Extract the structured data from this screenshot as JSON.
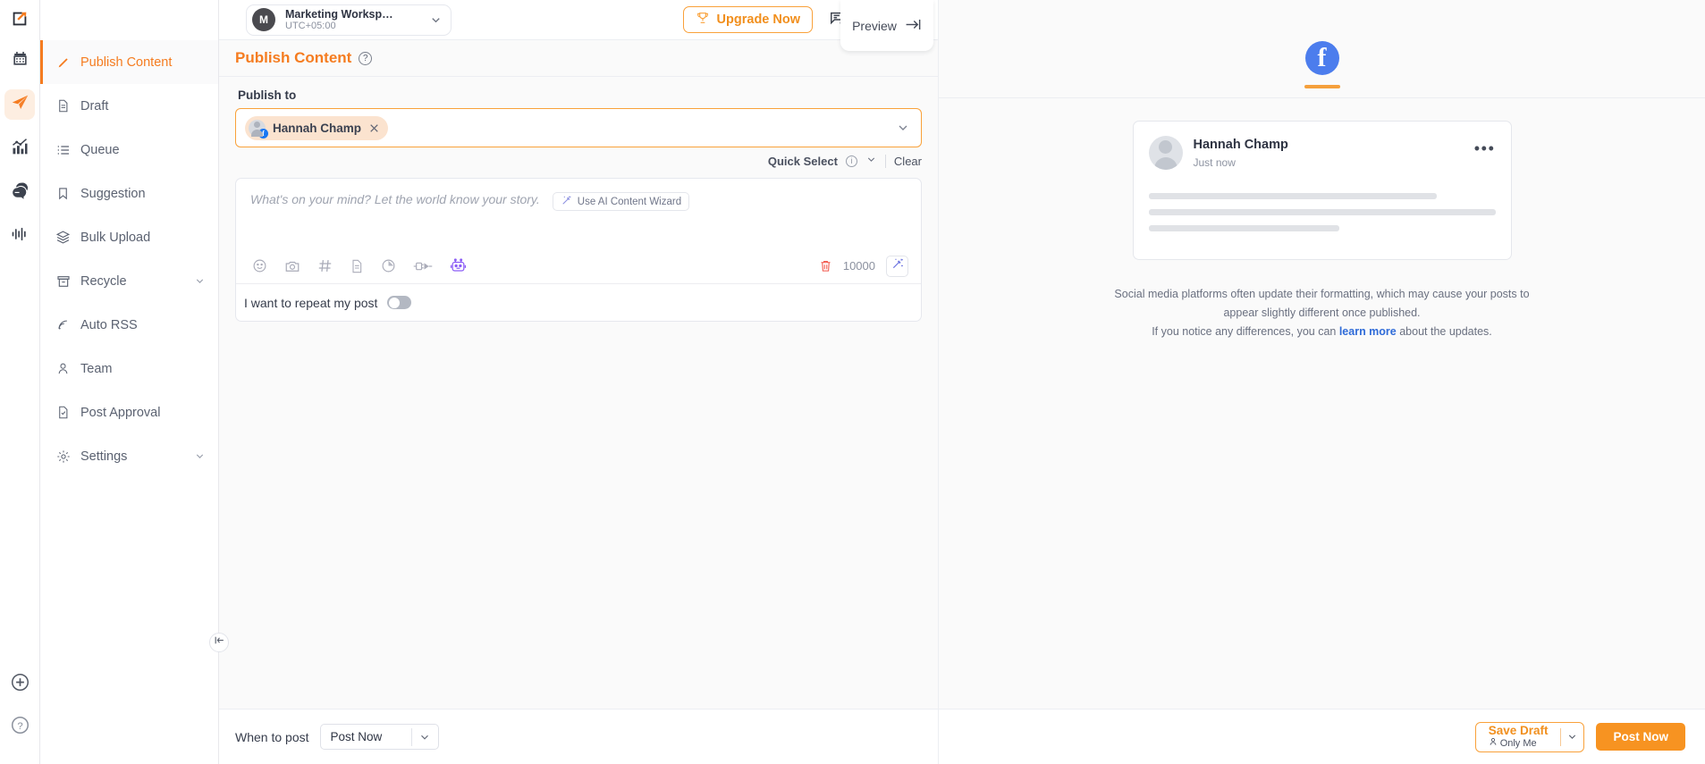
{
  "rail": {
    "logo_icon": "app-logo-icon",
    "items": [
      {
        "icon": "calendar-icon",
        "name": "calendar",
        "active": false
      },
      {
        "icon": "paper-plane-icon",
        "name": "publish",
        "active": true
      },
      {
        "icon": "analytics-chart-icon",
        "name": "analytics",
        "active": false
      },
      {
        "icon": "chat-bubbles-icon",
        "name": "inbox",
        "active": false
      },
      {
        "icon": "audio-waveform-icon",
        "name": "listening",
        "active": false
      }
    ],
    "bottom_items": [
      {
        "icon": "plus-circle-icon",
        "name": "add"
      },
      {
        "icon": "help-circle-icon",
        "name": "help"
      }
    ]
  },
  "workspace": {
    "initial": "M",
    "name": "Marketing Workspa...",
    "timezone": "UTC+05:00",
    "chevron_icon": "chevron-down-icon"
  },
  "header": {
    "upgrade_label": "Upgrade Now",
    "trophy_icon": "trophy-icon",
    "feedback_icon": "feedback-edit-icon",
    "bell_icon": "bell-icon",
    "avatar_icon": "user-avatar-icon",
    "accent_color": "#f57c20"
  },
  "sidebar": {
    "items": [
      {
        "label": "Publish Content",
        "icon": "pencil-icon",
        "active": true,
        "expandable": false
      },
      {
        "label": "Draft",
        "icon": "document-icon",
        "active": false,
        "expandable": false
      },
      {
        "label": "Queue",
        "icon": "list-icon",
        "active": false,
        "expandable": false
      },
      {
        "label": "Suggestion",
        "icon": "bookmark-icon",
        "active": false,
        "expandable": false
      },
      {
        "label": "Bulk Upload",
        "icon": "layers-icon",
        "active": false,
        "expandable": false
      },
      {
        "label": "Recycle",
        "icon": "archive-box-icon",
        "active": false,
        "expandable": true
      },
      {
        "label": "Auto RSS",
        "icon": "rss-icon",
        "active": false,
        "expandable": false
      },
      {
        "label": "Team",
        "icon": "person-icon",
        "active": false,
        "expandable": false
      },
      {
        "label": "Post Approval",
        "icon": "document-check-icon",
        "active": false,
        "expandable": false
      },
      {
        "label": "Settings",
        "icon": "gear-icon",
        "active": false,
        "expandable": true
      }
    ],
    "collapse_icon": "collapse-left-icon"
  },
  "page": {
    "title": "Publish Content",
    "help_icon": "question-mark-icon"
  },
  "publish_to": {
    "label": "Publish to",
    "accounts": [
      {
        "name": "Hannah Champ",
        "platform": "facebook",
        "platform_badge": "f",
        "remove_icon": "close-icon"
      }
    ],
    "dropdown_icon": "chevron-down-icon",
    "quick_select_label": "Quick Select",
    "quick_select_info_icon": "info-icon",
    "quick_select_chevron_icon": "chevron-down-icon",
    "clear_label": "Clear"
  },
  "composer": {
    "placeholder": "What's on your mind? Let the world know your story.",
    "value": "",
    "wizard_label": "Use AI Content Wizard",
    "wizard_icon": "magic-wand-icon",
    "toolbar_icons": [
      {
        "icon": "emoji-icon",
        "name": "emoji"
      },
      {
        "icon": "camera-icon",
        "name": "media"
      },
      {
        "icon": "hashtag-icon",
        "name": "hashtag"
      },
      {
        "icon": "document-icon",
        "name": "template"
      },
      {
        "icon": "clock-pie-icon",
        "name": "first-comment"
      },
      {
        "icon": "plug-icon",
        "name": "integration"
      },
      {
        "icon": "robot-icon",
        "name": "ai-assistant"
      }
    ],
    "delete_icon": "trash-icon",
    "char_limit": "10000",
    "magic_icon": "magic-wand-icon",
    "repeat_label": "I want to repeat my post",
    "repeat_enabled": false
  },
  "footer": {
    "when_label": "When to post",
    "when_value": "Post Now",
    "when_chevron_icon": "chevron-down-icon"
  },
  "preview": {
    "toggle_label": "Preview",
    "toggle_icon": "collapse-right-icon",
    "tabs": [
      {
        "platform": "facebook",
        "glyph": "f",
        "active": true,
        "color": "#4c7ded"
      }
    ],
    "card": {
      "author": "Hannah Champ",
      "time": "Just now",
      "menu_icon": "more-dots-icon",
      "avatar_icon": "user-avatar-icon"
    },
    "note_line1": "Social media platforms often update their formatting, which may cause your posts",
    "note_line2": "to appear slightly different once published.",
    "note_line3_pre": "If you notice any differences, you can ",
    "note_link": "learn more",
    "note_line3_post": " about the updates."
  },
  "actions": {
    "save_draft_label": "Save Draft",
    "save_draft_sub": "Only Me",
    "save_draft_person_icon": "person-icon",
    "save_draft_chevron_icon": "chevron-down-icon",
    "post_now_label": "Post Now",
    "primary_color": "#f79321"
  }
}
